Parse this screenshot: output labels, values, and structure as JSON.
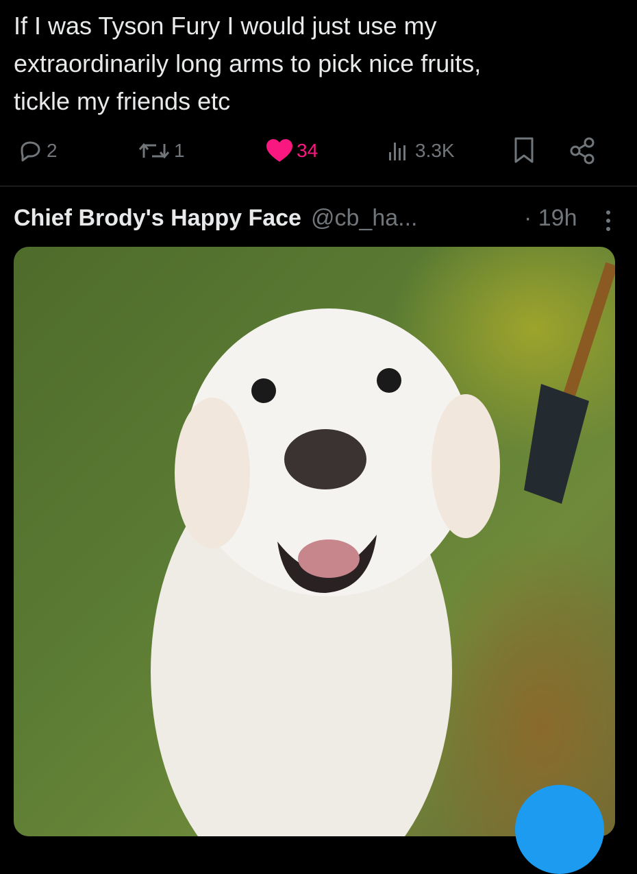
{
  "tweet": {
    "text": "If I was Tyson Fury I would just use my\nextraordinarily long arms to pick nice fruits,\ntickle my friends etc"
  },
  "actions": {
    "replies": "2",
    "reposts": "1",
    "likes": "34",
    "views": "3.3K",
    "icons": [
      "reply-icon",
      "repost-icon",
      "heart-icon",
      "views-icon",
      "bookmark-icon",
      "share-icon"
    ],
    "like_color": "#f91880",
    "muted_color": "#71767b"
  },
  "next_post": {
    "author_name": "Chief Brody's Happy Face",
    "handle": "@cb_ha...",
    "time": "· 19h",
    "image_subject": "white golden retriever smiling on grass",
    "accent": "#1d9bf0"
  }
}
